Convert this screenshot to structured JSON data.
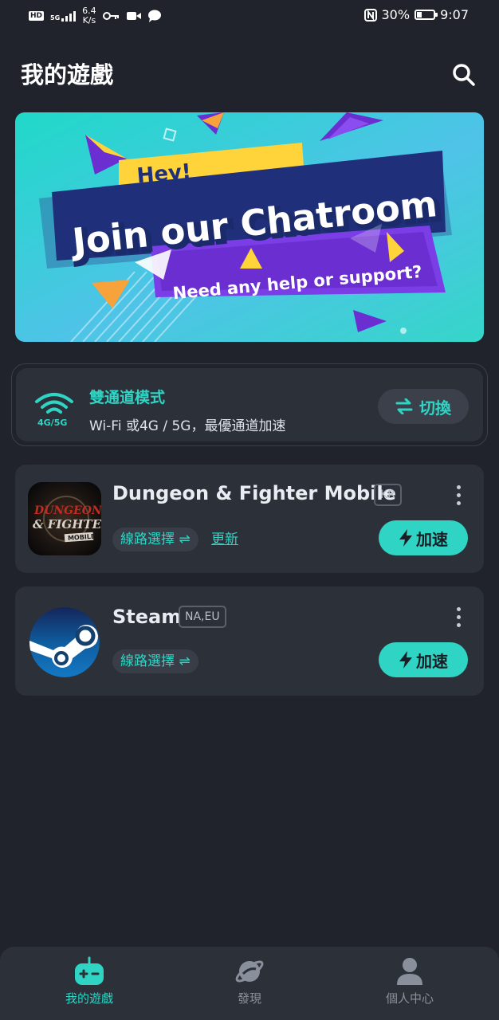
{
  "status_bar": {
    "hd": "HD",
    "network": "5G",
    "speed_value": "6.4",
    "speed_unit": "K/s",
    "battery": "30%",
    "battery_level": 0.3,
    "time": "9:07"
  },
  "header": {
    "title": "我的遊戲"
  },
  "banner": {
    "hey": "Hey!",
    "headline": "Join our Chatroom",
    "subline": "Need any help or support?"
  },
  "dual_channel": {
    "wifi_tag": "4G/5G",
    "title": "雙通道模式",
    "description": "Wi-Fi 或4G / 5G，最優通道加速",
    "switch_label": "切換"
  },
  "games": [
    {
      "name": "Dungeon & Fighter Mobile",
      "region": "KR",
      "route_label": "線路選擇 ⇌",
      "update_label": "更新",
      "boost_label": "加速",
      "icon_text_1": "DUNGEON",
      "icon_text_2": "& FIGHTER",
      "icon_text_3": "MOBILE"
    },
    {
      "name": "Steam",
      "region": "NA,EU",
      "route_label": "線路選擇 ⇌",
      "boost_label": "加速"
    }
  ],
  "tabs": [
    {
      "label": "我的遊戲",
      "icon": "gamepad-icon",
      "active": true
    },
    {
      "label": "發現",
      "icon": "planet-icon",
      "active": false
    },
    {
      "label": "個人中心",
      "icon": "person-icon",
      "active": false
    }
  ],
  "colors": {
    "accent": "#2fd4c4",
    "background": "#20232b",
    "card": "#2c3039",
    "inactive": "#8a909b"
  }
}
